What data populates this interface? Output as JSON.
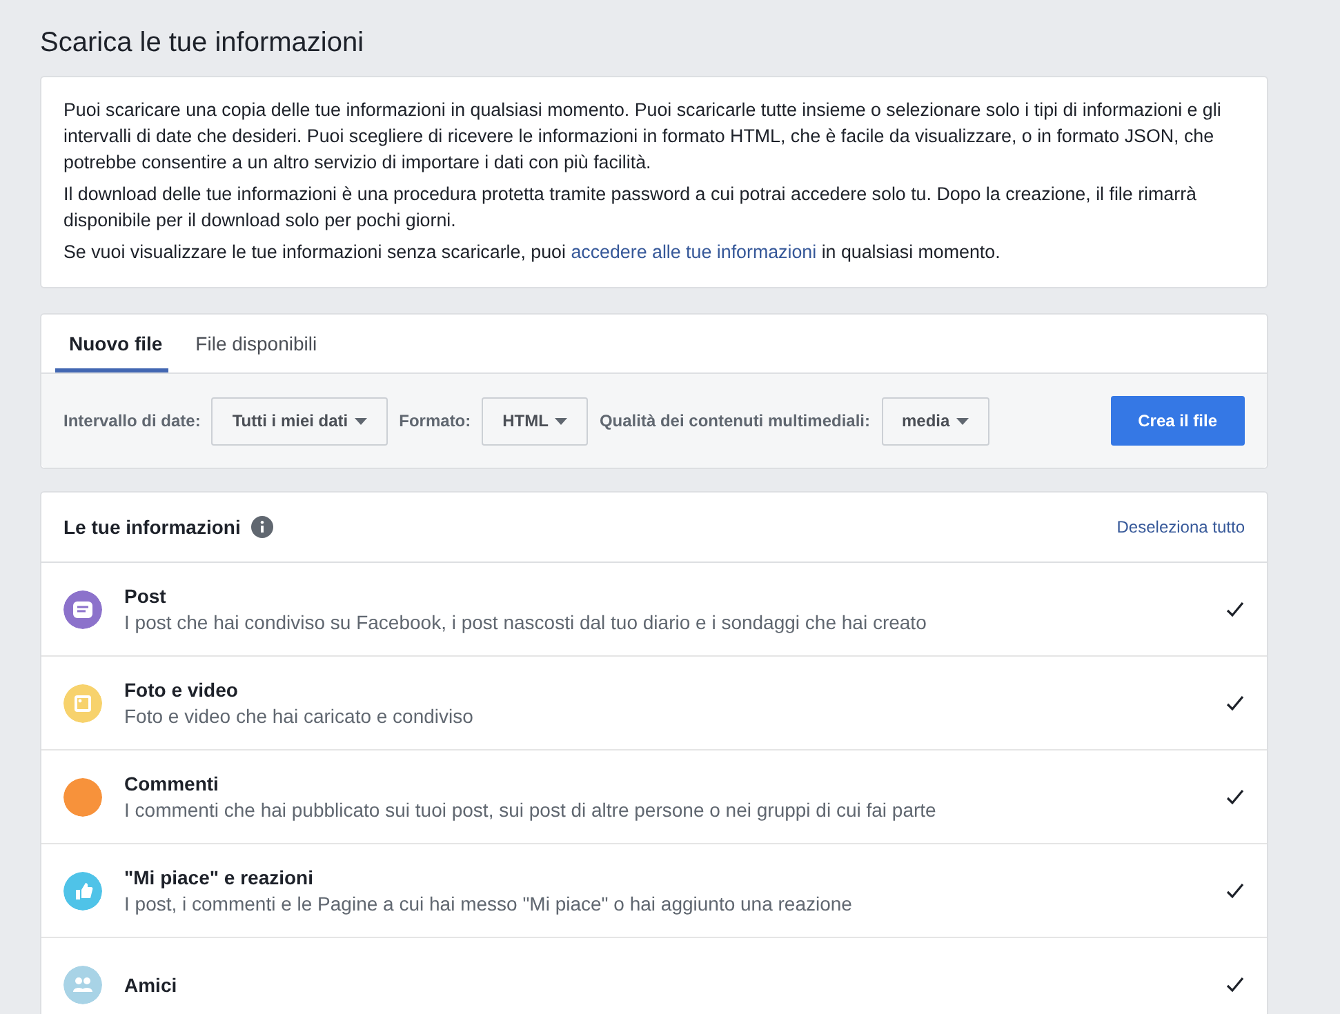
{
  "page_title": "Scarica le tue informazioni",
  "intro": {
    "paragraphs": [
      "Puoi scaricare una copia delle tue informazioni in qualsiasi momento. Puoi scaricarle tutte insieme o selezionare solo i tipi di informazioni e gli intervalli di date che desideri. Puoi scegliere di ricevere le informazioni in formato HTML, che è facile da visualizzare, o in formato JSON, che potrebbe consentire a un altro servizio di importare i dati con più facilità.",
      "Il download delle tue informazioni è una procedura protetta tramite password a cui potrai accedere solo tu. Dopo la creazione, il file rimarrà disponibile per il download solo per pochi giorni."
    ],
    "link_sentence": {
      "before": "Se vuoi visualizzare le tue informazioni senza scaricarle, puoi ",
      "link": "accedere alle tue informazioni",
      "after": " in qualsiasi momento."
    }
  },
  "tabs": [
    {
      "label": "Nuovo file",
      "selected": true
    },
    {
      "label": "File disponibili",
      "selected": false
    }
  ],
  "options": [
    {
      "label": "Intervallo di date:",
      "value": "Tutti i miei dati"
    },
    {
      "label": "Formato:",
      "value": "HTML"
    },
    {
      "label": "Qualità dei contenuti multimediali:",
      "value": "media"
    }
  ],
  "create_button": "Crea il file",
  "info_section": {
    "title": "Le tue informazioni",
    "deselect_all": "Deseleziona tutto",
    "items": [
      {
        "kind": "post",
        "color": "#8c72cb",
        "title": "Post",
        "description": "I post che hai condiviso su Facebook, i post nascosti dal tuo diario e i sondaggi che hai creato",
        "checked": true
      },
      {
        "kind": "photo",
        "color": "#f7d26c",
        "title": "Foto e video",
        "description": "Foto e video che hai caricato e condiviso",
        "checked": true
      },
      {
        "kind": "comment",
        "color": "#f7923b",
        "title": "Commenti",
        "description": "I commenti che hai pubblicato sui tuoi post, sui post di altre persone o nei gruppi di cui fai parte",
        "checked": true
      },
      {
        "kind": "like",
        "color": "#4fc3e8",
        "title": "\"Mi piace\" e reazioni",
        "description": "I post, i commenti e le Pagine a cui hai messo \"Mi piace\" o hai aggiunto una reazione",
        "checked": true
      },
      {
        "kind": "friends",
        "color": "#a8d3e6",
        "title": "Amici",
        "checked": true
      }
    ]
  }
}
